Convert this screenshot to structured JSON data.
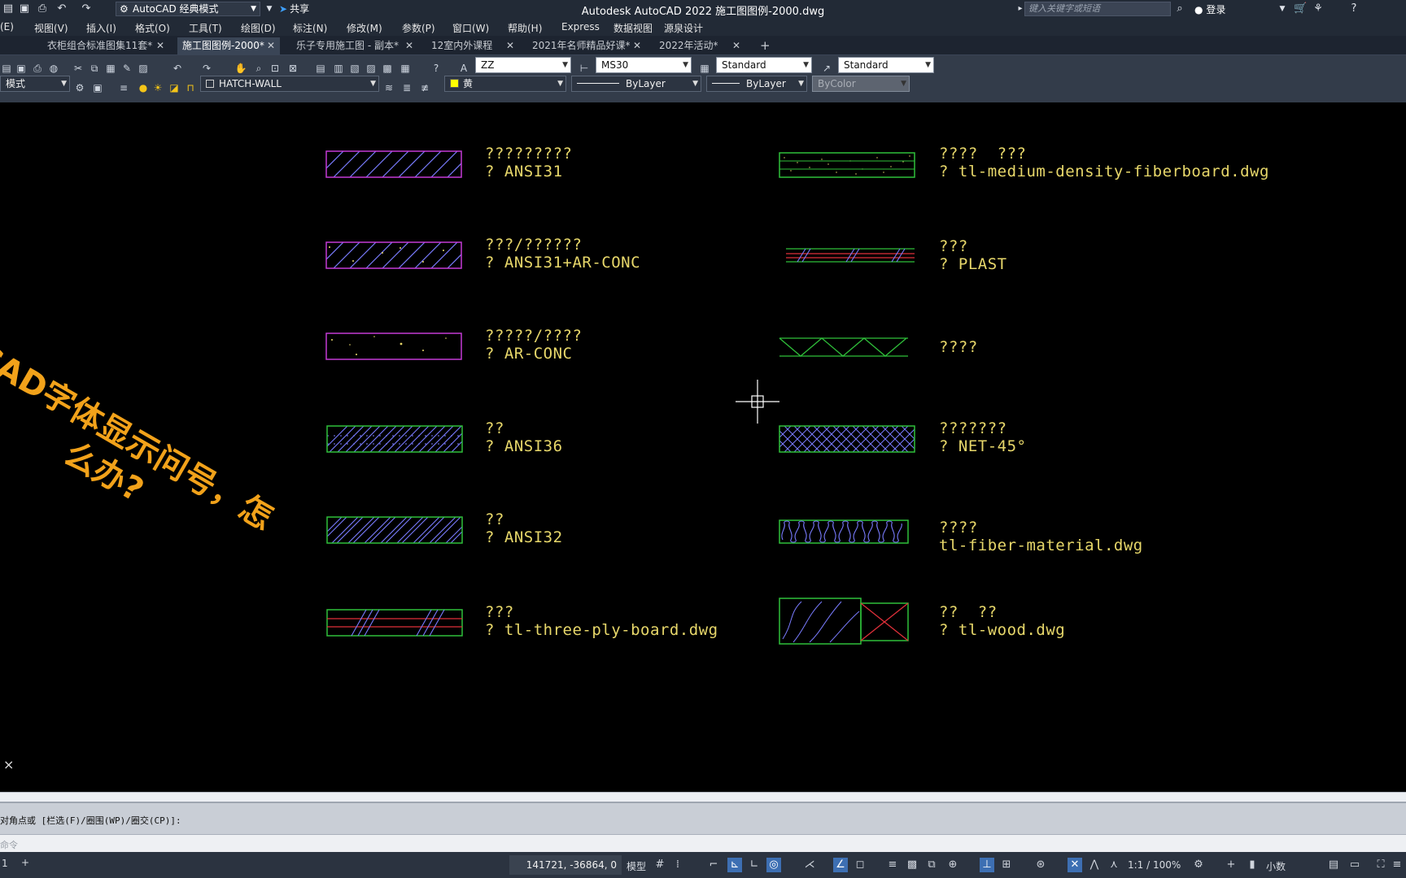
{
  "titlebar": {
    "workspace": "AutoCAD 经典模式",
    "share": "共享",
    "title": "Autodesk AutoCAD 2022    施工图图例-2000.dwg",
    "search_placeholder": "键入关键字或短语",
    "login": "登录"
  },
  "menu": {
    "items": [
      "(E)",
      "视图(V)",
      "插入(I)",
      "格式(O)",
      "工具(T)",
      "绘图(D)",
      "标注(N)",
      "修改(M)",
      "参数(P)",
      "窗口(W)",
      "帮助(H)",
      "Express",
      "数据视图",
      "源泉设计"
    ]
  },
  "tabs": {
    "items": [
      {
        "label": "衣柜组合标准图集11套*"
      },
      {
        "label": "施工图图例-2000*"
      },
      {
        "label": "乐子专用施工图 - 副本*"
      },
      {
        "label": "12室内外课程"
      },
      {
        "label": "2021年名师精品好课*"
      },
      {
        "label": "2022年活动*"
      }
    ]
  },
  "toolbar": {
    "text_style": "ZZ",
    "dim_style": "MS30",
    "table_style": "Standard",
    "mleader_style": "Standard",
    "model_mode": "模式",
    "layer": "HATCH-WALL",
    "color": "黄",
    "linetype": "ByLayer",
    "lineweight": "ByLayer",
    "plotstyle": "ByColor"
  },
  "drawing": {
    "watermark_line1": "CAD字体显示问号，怎",
    "watermark_line2": "么办?",
    "legend_left": [
      {
        "name": "?????????",
        "pattern": "? ANSI31"
      },
      {
        "name": "???/??????",
        "pattern": "? ANSI31+AR-CONC"
      },
      {
        "name": "?????/????",
        "pattern": "? AR-CONC"
      },
      {
        "name": "??",
        "pattern": "? ANSI36"
      },
      {
        "name": "??",
        "pattern": "? ANSI32"
      },
      {
        "name": "???",
        "pattern": "? tl-three-ply-board.dwg"
      }
    ],
    "legend_right": [
      {
        "name": "????  ???",
        "pattern": "? tl-medium-density-fiberboard.dwg"
      },
      {
        "name": "???",
        "pattern": "? PLAST"
      },
      {
        "name": "????",
        "pattern": ""
      },
      {
        "name": "???????",
        "pattern": "? NET-45°"
      },
      {
        "name": "????",
        "pattern": "tl-fiber-material.dwg"
      },
      {
        "name": "??  ??",
        "pattern": "? tl-wood.dwg"
      }
    ],
    "ucs_icon": "×"
  },
  "command": {
    "history": "对角点或 [栏选(F)/圈围(WP)/圈交(CP)]:",
    "placeholder": "命令"
  },
  "status": {
    "coords": "141721, -36864, 0",
    "model": "模型",
    "scale": "1:1 / 100%",
    "units": "小数"
  },
  "colors": {
    "hatch_magenta": "#c43bd6",
    "hatch_green": "#2fbf3a",
    "hatch_blue": "#7a7cff",
    "hatch_red": "#e0303a",
    "label_yellow": "#e7d76a",
    "watermark": "#f2a21a"
  }
}
